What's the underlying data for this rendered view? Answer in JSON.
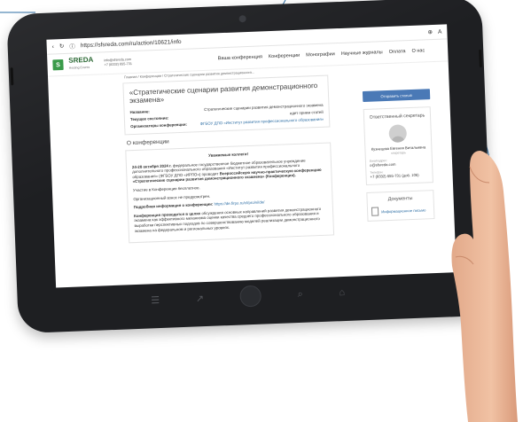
{
  "browser": {
    "url_text": "https://sfsreda.com/ru/action/10621/info",
    "back_icon": "back-arrow-icon",
    "refresh_icon": "refresh-icon",
    "info_icon": "info-icon",
    "zoom_icon": "zoom-icon",
    "read_icon": "read-aloud-icon"
  },
  "site": {
    "logo_main": "SREDA",
    "logo_sub": "Hosting Events",
    "email": "info@sfsreda.com",
    "phone": "+7 (8332) 655-731",
    "menu": [
      "Ваша конференция",
      "Конференции",
      "Монографии",
      "Научные журналы",
      "Оплата",
      "О нас"
    ]
  },
  "breadcrumbs": "Главная / Конференции / Стратегические сценарии развития демонстрационного...",
  "page": {
    "title": "«Стратегические сценарии развития демонстрационного экзамена»",
    "info": [
      {
        "key": "Название:",
        "value": "Стратегические сценарии развития демонстрационного экзамена",
        "link": false
      },
      {
        "key": "Текущее состояние:",
        "value": "идет прием статей",
        "link": false
      },
      {
        "key": "Организаторы конференции:",
        "value": "ФГБОУ ДПО «Институт развития профессионального образования»",
        "link": true
      }
    ],
    "about_title": "О конференции",
    "greeting": "Уважаемые коллеги!",
    "p1_bold": "24-28 октября 2024 г.",
    "p1_rest": " федеральное государственное бюджетное образовательное учреждение дополнительного профессионального образования «Институт развития профессионального образования» (ФГБОУ ДПО «ИРПО») проводит",
    "p1_bold2": "Всероссийскую научно-практическую конференцию «Стратегические сценарии развития демонстрационного экзамена» (Конференция).",
    "p2": "Участие в Конференции бесплатное.",
    "p3": "Организационный взнос не предусмотрен.",
    "p4_bold": "Подробная информация о конференции:",
    "p4_link": "https://de.firpo.ru/ct/pro/vi/de/",
    "p5_bold": "Конференция проводится в целях",
    "p5_rest": " обсуждения основных направлений развития демонстрационного экзамена как эффективного механизма оценки качества среднего профессионального образования и выработки перспективных подходов по совершенствованию моделей реализации демонстрационного экзамена на федеральном и региональных уровнях."
  },
  "sidebar": {
    "register_label": "Отправить статью",
    "secretary_title": "Ответственный секретарь",
    "secretary_name": "Кузнецова Евгения Витальевна",
    "secretary_role": "секретарь",
    "email_label": "Email-адрес:",
    "email": "o@sfsreda.com",
    "phone_label": "Телефон:",
    "phone": "+7 (8332) 655-731 (доб. 106)",
    "docs_title": "Документы",
    "doc_item": "Информационное письмо"
  },
  "colors": {
    "accent": "#4a79b6",
    "brand": "#3a9b4a",
    "link": "#2b6ca3"
  }
}
